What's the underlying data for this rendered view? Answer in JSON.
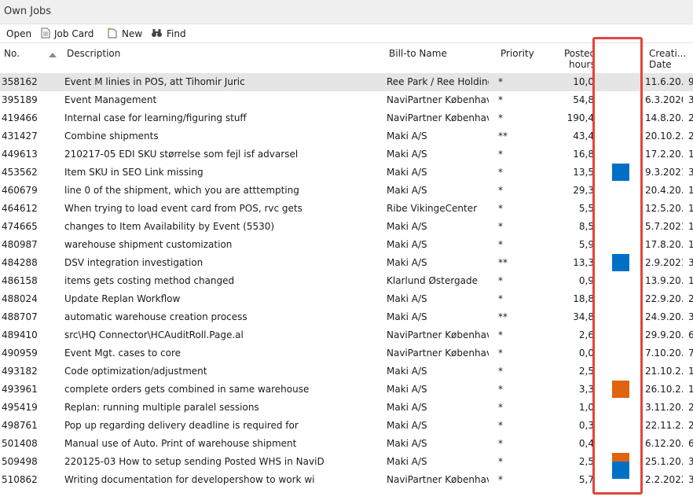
{
  "window": {
    "title": "Own Jobs"
  },
  "toolbar": {
    "open": "Open",
    "job_card": "Job Card",
    "new": "New",
    "find": "Find"
  },
  "columns": {
    "no": "No.",
    "description": "Description",
    "bill_to": "Bill-to Name",
    "priority": "Priority",
    "posted_hours_1": "Posted",
    "posted_hours_2": "hours",
    "creation_1": "Creati...",
    "creation_2": "Date"
  },
  "colors": {
    "blue": "#0070c6",
    "orange": "#e06310",
    "highlight": "#e0463c",
    "selected_row": "#e5e5e5"
  },
  "rows": [
    {
      "no": "358162",
      "desc": "Event M linies in POS, att Tihomir Juric",
      "bill": "Ree Park / Ree Holding",
      "prio": "*",
      "hours": "10,0",
      "date": "11.6.20..",
      "extra": "9",
      "color": ""
    },
    {
      "no": "395189",
      "desc": "Event Management",
      "bill": "NaviPartner København",
      "prio": "*",
      "hours": "54,8",
      "date": "6.3.2020.",
      "extra": "3",
      "color": ""
    },
    {
      "no": "419466",
      "desc": "Internal case for learning/figuring stuff",
      "bill": "NaviPartner København",
      "prio": "*",
      "hours": "190,4",
      "date": "14.8.20..",
      "extra": "2",
      "color": ""
    },
    {
      "no": "431427",
      "desc": "Combine shipments",
      "bill": "Maki A/S",
      "prio": "**",
      "hours": "43,4",
      "date": "20.10.2..",
      "extra": "2",
      "color": ""
    },
    {
      "no": "449613",
      "desc": "210217-05 EDI SKU størrelse som fejl isf advarsel",
      "bill": "Maki A/S",
      "prio": "*",
      "hours": "16,8",
      "date": "17.2.20..",
      "extra": "1",
      "color": ""
    },
    {
      "no": "453562",
      "desc": "Item SKU in SEO Link missing",
      "bill": "Maki A/S",
      "prio": "*",
      "hours": "13,5",
      "date": "9.3.2021.",
      "extra": "3",
      "color": "blue"
    },
    {
      "no": "460679",
      "desc": "line 0 of the shipment, which you are atttempting",
      "bill": "Maki A/S",
      "prio": "*",
      "hours": "29,3",
      "date": "20.4.20..",
      "extra": "1",
      "color": ""
    },
    {
      "no": "464612",
      "desc": "When trying to load event card from POS, rvc gets",
      "bill": "Ribe VikingeCenter",
      "prio": "*",
      "hours": "5,5",
      "date": "12.5.20..",
      "extra": "1",
      "color": ""
    },
    {
      "no": "474665",
      "desc": "changes to Item Availability by Event (5530)",
      "bill": "Maki A/S",
      "prio": "*",
      "hours": "8,5",
      "date": "5.7.2021.",
      "extra": "1",
      "color": ""
    },
    {
      "no": "480987",
      "desc": "warehouse shipment customization",
      "bill": "Maki A/S",
      "prio": "*",
      "hours": "5,9",
      "date": "17.8.20..",
      "extra": "1",
      "color": ""
    },
    {
      "no": "484288",
      "desc": "DSV integration investigation",
      "bill": "Maki A/S",
      "prio": "**",
      "hours": "13,3",
      "date": "2.9.2021.",
      "extra": "3",
      "color": "blue"
    },
    {
      "no": "486158",
      "desc": "items gets costing method changed",
      "bill": "Klarlund Østergade",
      "prio": "*",
      "hours": "0,9",
      "date": "13.9.20..",
      "extra": "1",
      "color": ""
    },
    {
      "no": "488024",
      "desc": "Update Replan Workflow",
      "bill": "Maki A/S",
      "prio": "*",
      "hours": "18,8",
      "date": "22.9.20..",
      "extra": "2",
      "color": ""
    },
    {
      "no": "488707",
      "desc": "automatic warehouse creation process",
      "bill": "Maki A/S",
      "prio": "**",
      "hours": "34,8",
      "date": "24.9.20..",
      "extra": "3",
      "color": ""
    },
    {
      "no": "489410",
      "desc": "src\\HQ Connector\\HCAuditRoll.Page.al",
      "bill": "NaviPartner København",
      "prio": "*",
      "hours": "2,6",
      "date": "29.9.20..",
      "extra": "6",
      "color": ""
    },
    {
      "no": "490959",
      "desc": "Event Mgt. cases to core",
      "bill": "NaviPartner København",
      "prio": "*",
      "hours": "0,0",
      "date": "7.10.20..",
      "extra": "7",
      "color": ""
    },
    {
      "no": "493182",
      "desc": "Code optimization/adjustment",
      "bill": "Maki A/S",
      "prio": "*",
      "hours": "2,5",
      "date": "21.10.2..",
      "extra": "1",
      "color": ""
    },
    {
      "no": "493961",
      "desc": "complete orders gets combined in same warehouse",
      "bill": "Maki A/S",
      "prio": "*",
      "hours": "3,3",
      "date": "26.10.2..",
      "extra": "1",
      "color": "orange"
    },
    {
      "no": "495419",
      "desc": "Replan: running multiple paralel sessions",
      "bill": "Maki A/S",
      "prio": "*",
      "hours": "1,0",
      "date": "3.11.20..",
      "extra": "2",
      "color": ""
    },
    {
      "no": "498761",
      "desc": "Pop up regarding delivery deadline is required for",
      "bill": "Maki A/S",
      "prio": "*",
      "hours": "0,3",
      "date": "22.11.2..",
      "extra": "2",
      "color": ""
    },
    {
      "no": "501408",
      "desc": "Manual use of Auto. Print of warehouse shipment",
      "bill": "Maki A/S",
      "prio": "*",
      "hours": "0,4",
      "date": "6.12.20..",
      "extra": "6",
      "color": ""
    },
    {
      "no": "509498",
      "desc": "220125-03 How to setup sending Posted WHS in NaviD",
      "bill": "Maki A/S",
      "prio": "*",
      "hours": "2,5",
      "date": "25.1.20..",
      "extra": "3",
      "color": "orange"
    },
    {
      "no": "510862",
      "desc": "Writing documentation for developershow to work wi",
      "bill": "NaviPartner København",
      "prio": "*",
      "hours": "5,7",
      "date": "2.2.2022.",
      "extra": "3",
      "color": "blue"
    }
  ]
}
